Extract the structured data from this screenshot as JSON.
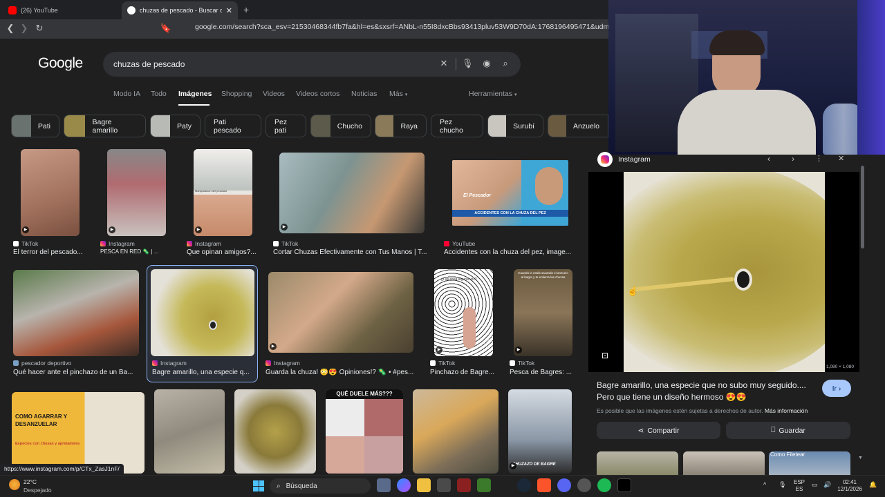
{
  "browser": {
    "tabs": [
      {
        "label": "(26) YouTube",
        "active": false
      },
      {
        "label": "chuzas de pescado - Buscar con Go",
        "active": true
      }
    ],
    "url": "google.com/search?sca_esv=21530468344fb7fa&hl=es&sxsrf=ANbL-n55I8dxcBbs93413pluv53W9D70dA:1768196495471&udm=2&fbs=A"
  },
  "google": {
    "logo": "Google",
    "query": "chuzas de pescado",
    "nav_tabs": [
      "Modo IA",
      "Todo",
      "Imágenes",
      "Shopping",
      "Videos",
      "Videos cortos",
      "Noticias",
      "Más"
    ],
    "tools_label": "Herramientas",
    "chips": [
      "Pati",
      "Bagre amarillo",
      "Paty",
      "Pati pescado",
      "Pez pati",
      "Chucho",
      "Raya",
      "Pez chucho",
      "Surubí",
      "Anzuelo"
    ],
    "results_row1": [
      {
        "source": "TikTok",
        "title": "El terror del pescado..."
      },
      {
        "source": "Instagram",
        "title": "PESCA EN RED 🦠 | ..."
      },
      {
        "source": "Instagram",
        "title": "Que opinan amigos?..."
      },
      {
        "source": "TikTok",
        "title": "Cortar Chuzas Efectivamente con Tus Manos | T..."
      },
      {
        "source": "YouTube",
        "title": "Accidentes con la chuza del pez, image..."
      }
    ],
    "results_row2": [
      {
        "source": "pescador deportivo",
        "title": "Qué hacer ante el pinchazo de un Ba..."
      },
      {
        "source": "Instagram",
        "title": "Bagre amarillo, una especie q..."
      },
      {
        "source": "Instagram",
        "title": "Guarda la chuza! 😳😍 Opiniones!? 🦠 • #pes..."
      },
      {
        "source": "TikTok",
        "title": "Pinchazo de Bagre..."
      },
      {
        "source": "TikTok",
        "title": "Pesca de Bagres: ..."
      }
    ],
    "thumb_texts": {
      "accidentes_1": "El Pescador",
      "accidentes_2": "ACCIDENTES CON LA CHUZA DEL PEZ",
      "manipulacion": "Manipulación del pescado",
      "como_agarrar": "COMO AGARRAR Y DESANZUELAR",
      "especies": "Especies con chusas y apretadores",
      "que_duele": "QUÉ DUELE MÁS???",
      "chuzazo": "CHUZAZO DE BAGRE",
      "las_pasa": "¿Las pasa alguna vez?",
      "cuando_sacando": "Cuando le estás sacando el anzuelo al bagre y te entierra las chuzas",
      "como_filetear": "Como Filetear"
    }
  },
  "panel": {
    "source": "Instagram",
    "caption": "Bagre amarillo, una especie que no subo muy seguido.... Pero que tiene un diseño hermoso 😍😍",
    "note": "Es posible que las imágenes estén sujetas a derechos de autor.",
    "more_info": "Más información",
    "go_label": "Ir",
    "share_label": "Compartir",
    "save_label": "Guardar",
    "dimensions": "1,080 × 1,080"
  },
  "status_url": "https://www.instagram.com/p/CTx_ZasJ1nF/",
  "taskbar": {
    "temp": "22°C",
    "weather": "Despejado",
    "search_placeholder": "Búsqueda",
    "lang1": "ESP",
    "lang2": "ES",
    "time": "02:41",
    "date": "12/1/2026"
  },
  "colors": {
    "accent": "#8ab4f8",
    "go_button": "#a8c7fa",
    "page_bg": "#1f1f1f"
  }
}
